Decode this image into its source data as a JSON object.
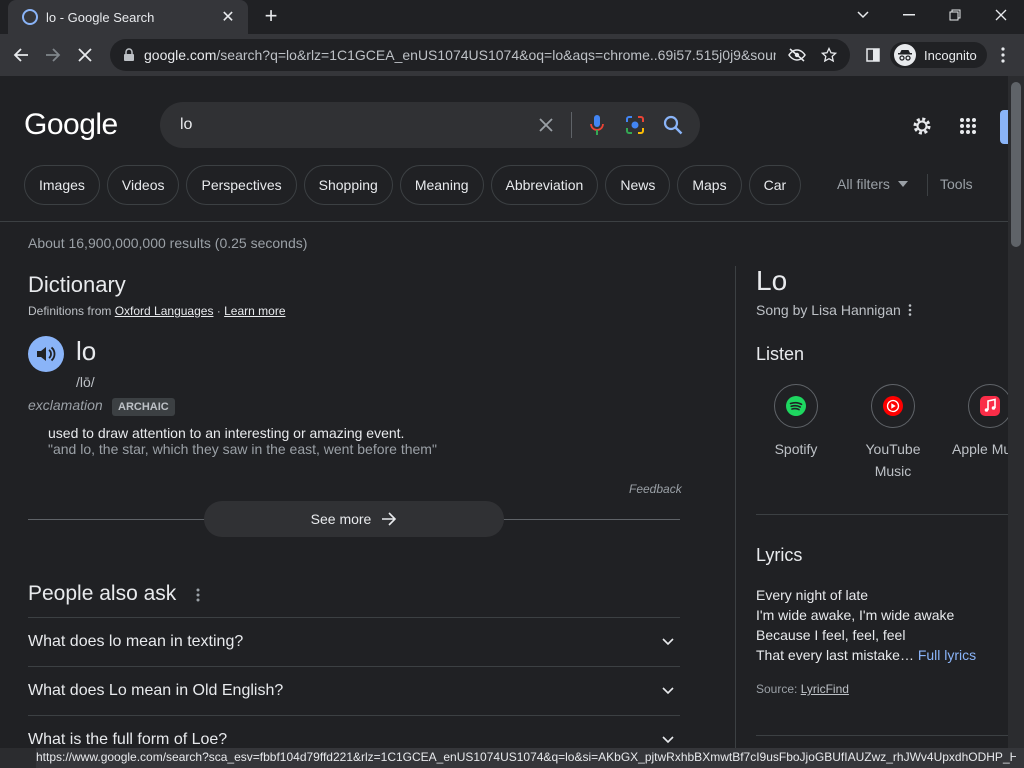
{
  "browser": {
    "tab_title": "lo - Google Search",
    "tab_close": "✕",
    "new_tab": "+",
    "url_host": "google.com",
    "url_rest": "/search?q=lo&rlz=1C1GCEA_enUS1074US1074&oq=lo&aqs=chrome..69i57.515j0j9&sour...",
    "incognito_label": "Incognito"
  },
  "search": {
    "logo": "Google",
    "query": "lo"
  },
  "chips": [
    "Images",
    "Videos",
    "Perspectives",
    "Shopping",
    "Meaning",
    "Abbreviation",
    "News",
    "Maps",
    "Car"
  ],
  "filters": {
    "all_filters": "All filters",
    "tools": "Tools"
  },
  "stats": "About 16,900,000,000 results (0.25 seconds)",
  "dictionary": {
    "heading": "Dictionary",
    "source_prefix": "Definitions from ",
    "source_link": "Oxford Languages",
    "source_sep": " · ",
    "learn_more": "Learn more",
    "word": "lo",
    "phonetic": "/lō/",
    "part_of_speech": "exclamation",
    "tag": "ARCHAIC",
    "definition": "used to draw attention to an interesting or amazing event.",
    "example": "\"and lo, the star, which they saw in the east, went before them\"",
    "feedback": "Feedback",
    "see_more": "See more"
  },
  "people_also_ask": {
    "heading": "People also ask",
    "questions": [
      "What does lo mean in texting?",
      "What does Lo mean in Old English?",
      "What is the full form of Loe?"
    ]
  },
  "knowledge_panel": {
    "title": "Lo",
    "subtitle": "Song by Lisa Hannigan",
    "listen_heading": "Listen",
    "services": [
      {
        "name_line1": "Spotify",
        "name_line2": ""
      },
      {
        "name_line1": "YouTube",
        "name_line2": "Music"
      },
      {
        "name_line1": "Apple Mu",
        "name_line2": ""
      }
    ],
    "lyrics_heading": "Lyrics",
    "lyrics": [
      "Every night of late",
      "I'm wide awake, I'm wide awake",
      "Because I feel, feel, feel",
      "That every last mistake…"
    ],
    "full_lyrics": "Full lyrics",
    "source_prefix": "Source: ",
    "source_link": "LyricFind"
  },
  "statusbar_url": "https://www.google.com/search?sca_esv=fbbf104d79ffd221&rlz=1C1GCEA_enUS1074US1074&q=lo&si=AKbGX_pjtwRxhbBXmwtBf7cI9usFboJjoGBUfIAUZwz_rhJWv4UpxdhODHP_Hp0...",
  "colors": {
    "accent": "#8ab4f8",
    "background": "#202124",
    "surface": "#303134"
  }
}
